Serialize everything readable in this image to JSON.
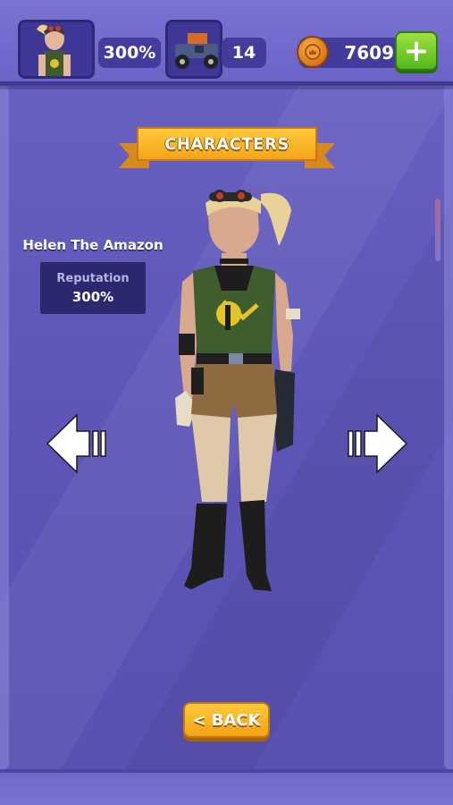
{
  "header": {
    "reputation_value": "300%",
    "cars_count": "14",
    "coins": "7609",
    "add_label": "+"
  },
  "banner": {
    "title": "CHARACTERS"
  },
  "character": {
    "name": "Helen The Amazon",
    "reputation_label": "Reputation",
    "reputation_value": "300%"
  },
  "footer": {
    "back_label": "BACK",
    "back_chevron": "<"
  },
  "icons": {
    "coin": "crown-coin-icon",
    "add": "plus-icon",
    "prev": "arrow-left-icon",
    "next": "arrow-right-icon"
  },
  "colors": {
    "background": "#5e56b4",
    "accent": "#f3a51a",
    "add_button": "#54b81c",
    "panel": "#2c2870"
  }
}
